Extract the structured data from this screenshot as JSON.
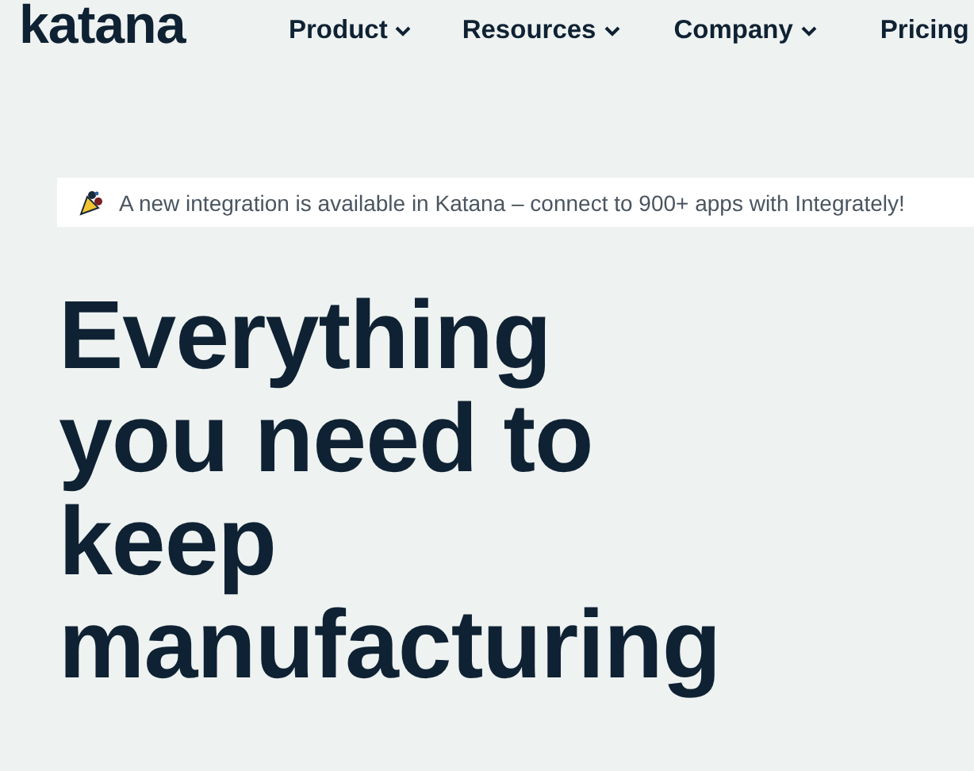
{
  "logo": "katana",
  "nav": [
    {
      "label": "Product",
      "dropdown": true
    },
    {
      "label": "Resources",
      "dropdown": true
    },
    {
      "label": "Company",
      "dropdown": true
    },
    {
      "label": "Pricing",
      "dropdown": false
    }
  ],
  "announcement": {
    "text": "A new integration is available in Katana – connect to 900+ apps with Integrately!"
  },
  "headline": "Everything you need to keep manufacturing"
}
